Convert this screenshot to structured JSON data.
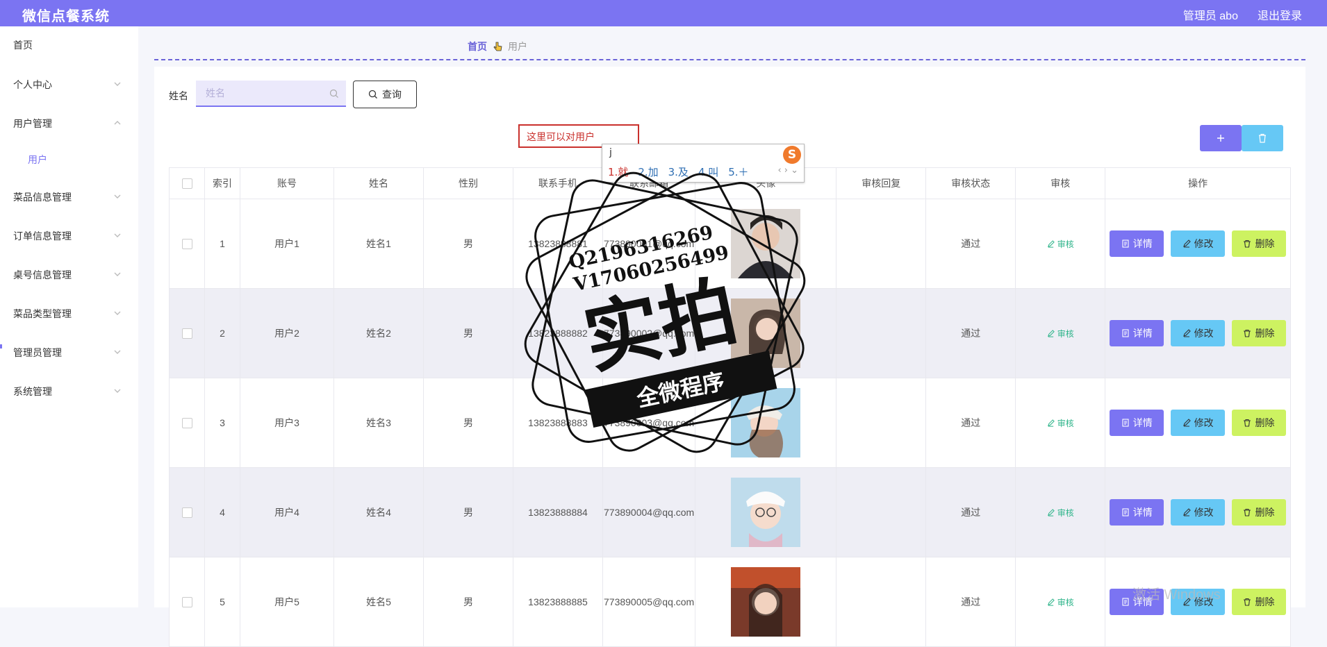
{
  "app": {
    "title": "微信点餐系统"
  },
  "topbar": {
    "admin_label": "管理员 abo",
    "logout_label": "退出登录"
  },
  "sidebar": {
    "items": [
      {
        "label": "首页"
      },
      {
        "label": "个人中心"
      },
      {
        "label": "用户管理"
      },
      {
        "label": "用户"
      },
      {
        "label": "菜品信息管理"
      },
      {
        "label": "订单信息管理"
      },
      {
        "label": "桌号信息管理"
      },
      {
        "label": "菜品类型管理"
      },
      {
        "label": "管理员管理"
      },
      {
        "label": "系统管理"
      }
    ]
  },
  "breadcrumb": {
    "home": "首页",
    "current": "用户"
  },
  "search": {
    "label": "姓名",
    "placeholder": "姓名",
    "button": "查询"
  },
  "overlay": {
    "tooltip_text": "这里可以对用户",
    "ime_input": "j",
    "ime_candidates": [
      "1.就",
      "2.加",
      "3.及",
      "4.叫",
      "5.＋"
    ],
    "ime_logo": "S",
    "watermark_lines": [
      "Q2196316269",
      "V17060256499",
      "实拍",
      "全微程序"
    ],
    "windows_watermark": "激活 Windows"
  },
  "table": {
    "headers": [
      "索引",
      "账号",
      "姓名",
      "性别",
      "联系手机",
      "联系邮箱",
      "头像",
      "审核回复",
      "审核状态",
      "审核",
      "操作"
    ],
    "audit_label": "审核",
    "ops": {
      "detail": "详情",
      "edit": "修改",
      "delete": "删除"
    },
    "rows": [
      {
        "index": "1",
        "account": "用户1",
        "name": "姓名1",
        "gender": "男",
        "phone": "13823888881",
        "email": "773890001@qq.com",
        "reply": "",
        "status": "通过"
      },
      {
        "index": "2",
        "account": "用户2",
        "name": "姓名2",
        "gender": "男",
        "phone": "13823888882",
        "email": "773890002@qq.com",
        "reply": "",
        "status": "通过"
      },
      {
        "index": "3",
        "account": "用户3",
        "name": "姓名3",
        "gender": "男",
        "phone": "13823888883",
        "email": "773890003@qq.com",
        "reply": "",
        "status": "通过"
      },
      {
        "index": "4",
        "account": "用户4",
        "name": "姓名4",
        "gender": "男",
        "phone": "13823888884",
        "email": "773890004@qq.com",
        "reply": "",
        "status": "通过"
      },
      {
        "index": "5",
        "account": "用户5",
        "name": "姓名5",
        "gender": "男",
        "phone": "13823888885",
        "email": "773890005@qq.com",
        "reply": "",
        "status": "通过"
      }
    ]
  },
  "colors": {
    "accent": "#7b74f2",
    "info": "#66c8f5",
    "warn": "#cdf261",
    "success": "#2eb48a"
  }
}
